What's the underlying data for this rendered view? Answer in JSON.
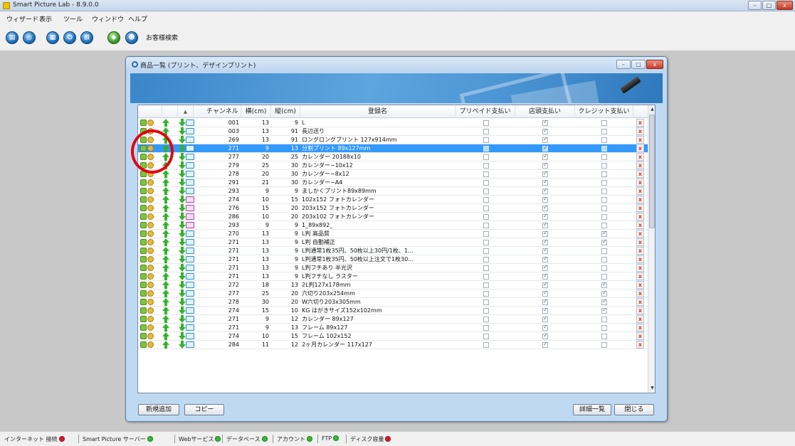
{
  "app": {
    "title": "Smart Picture Lab - 8.9.0.0"
  },
  "window_controls": {
    "minimize": "–",
    "maximize": "□",
    "close": "x"
  },
  "menu": [
    "ウィザード",
    "表示",
    "ツール",
    "ウィンドウ",
    "ヘルプ"
  ],
  "toolbar": {
    "icons": [
      "print-icon",
      "globe-icon",
      "calendar-icon",
      "power-icon",
      "network-icon",
      "photos-icon",
      "customer-icon"
    ],
    "customer_search_label": "お客様検索"
  },
  "dialog": {
    "title": "商品一覧 (プリント、デザインプリント)",
    "columns": {
      "sort_indicator": "▲",
      "channel": "チャンネル",
      "width": "横(cm)",
      "height": "縦(cm)",
      "name": "登録名",
      "prepaid": "プリペイド支払い",
      "store": "店頭支払い",
      "credit": "クレジット支払い"
    },
    "rows": [
      {
        "channel": "001",
        "w": "13",
        "h": "9",
        "name": "L",
        "prepaid": false,
        "store": true,
        "credit": false,
        "icon": "doc"
      },
      {
        "channel": "003",
        "w": "13",
        "h": "91",
        "name": "長辺送り",
        "prepaid": false,
        "store": true,
        "credit": false,
        "icon": "doc"
      },
      {
        "channel": "269",
        "w": "13",
        "h": "91",
        "name": "ロングロングプリント 127x914mm",
        "prepaid": false,
        "store": true,
        "credit": false,
        "icon": "doc"
      },
      {
        "channel": "271",
        "w": "9",
        "h": "13",
        "name": "分割プリント 89x127mm",
        "prepaid": false,
        "store": true,
        "credit": false,
        "icon": "doc",
        "selected": true
      },
      {
        "channel": "277",
        "w": "20",
        "h": "25",
        "name": "カレンダー 20188x10",
        "prepaid": false,
        "store": true,
        "credit": false,
        "icon": "doc"
      },
      {
        "channel": "279",
        "w": "25",
        "h": "30",
        "name": "カレンダー−10x12",
        "prepaid": false,
        "store": true,
        "credit": false,
        "icon": "doc"
      },
      {
        "channel": "278",
        "w": "20",
        "h": "30",
        "name": "カレンダー−8x12",
        "prepaid": false,
        "store": true,
        "credit": false,
        "icon": "doc"
      },
      {
        "channel": "291",
        "w": "21",
        "h": "30",
        "name": "カレンダー−A4",
        "prepaid": false,
        "store": true,
        "credit": false,
        "icon": "doc"
      },
      {
        "channel": "293",
        "w": "9",
        "h": "9",
        "name": "ましかくプリント89x89mm",
        "prepaid": false,
        "store": true,
        "credit": false,
        "icon": "doc"
      },
      {
        "channel": "274",
        "w": "10",
        "h": "15",
        "name": "102x152 フォトカレンダー",
        "prepaid": false,
        "store": true,
        "credit": false,
        "icon": "cal"
      },
      {
        "channel": "276",
        "w": "15",
        "h": "20",
        "name": "203x152 フォトカレンダー",
        "prepaid": false,
        "store": true,
        "credit": false,
        "icon": "cal"
      },
      {
        "channel": "286",
        "w": "10",
        "h": "20",
        "name": "203x102 フォトカレンダー",
        "prepaid": false,
        "store": true,
        "credit": false,
        "icon": "cal"
      },
      {
        "channel": "293",
        "w": "9",
        "h": "9",
        "name": "1_89x892_",
        "prepaid": false,
        "store": true,
        "credit": false,
        "icon": "cal"
      },
      {
        "channel": "270",
        "w": "13",
        "h": "9",
        "name": "L判 高品質",
        "prepaid": false,
        "store": true,
        "credit": true,
        "icon": "doc"
      },
      {
        "channel": "271",
        "w": "13",
        "h": "9",
        "name": "L判 自動補正",
        "prepaid": false,
        "store": true,
        "credit": true,
        "icon": "doc"
      },
      {
        "channel": "271",
        "w": "13",
        "h": "9",
        "name": "L判通常1枚35円、50枚以上30円/1枚、1...",
        "prepaid": false,
        "store": true,
        "credit": false,
        "icon": "doc"
      },
      {
        "channel": "271",
        "w": "13",
        "h": "9",
        "name": "L判通常1枚35円、50枚以上注文で1枚30...",
        "prepaid": false,
        "store": true,
        "credit": false,
        "icon": "doc"
      },
      {
        "channel": "271",
        "w": "13",
        "h": "9",
        "name": "L判フチあり 半光沢",
        "prepaid": false,
        "store": true,
        "credit": false,
        "icon": "doc"
      },
      {
        "channel": "271",
        "w": "13",
        "h": "9",
        "name": "L判フチなし ラスター",
        "prepaid": false,
        "store": true,
        "credit": false,
        "icon": "doc"
      },
      {
        "channel": "272",
        "w": "18",
        "h": "13",
        "name": "2L判127x178mm",
        "prepaid": false,
        "store": true,
        "credit": true,
        "icon": "doc"
      },
      {
        "channel": "277",
        "w": "25",
        "h": "20",
        "name": "六切り203x254mm",
        "prepaid": false,
        "store": true,
        "credit": true,
        "icon": "doc"
      },
      {
        "channel": "278",
        "w": "30",
        "h": "20",
        "name": "W六切り203x305mm",
        "prepaid": false,
        "store": true,
        "credit": true,
        "icon": "doc"
      },
      {
        "channel": "274",
        "w": "15",
        "h": "10",
        "name": "KG はがきサイズ152x102mm",
        "prepaid": false,
        "store": true,
        "credit": true,
        "icon": "doc"
      },
      {
        "channel": "271",
        "w": "9",
        "h": "12",
        "name": "カレンダー 89x127",
        "prepaid": false,
        "store": true,
        "credit": false,
        "icon": "doc"
      },
      {
        "channel": "271",
        "w": "9",
        "h": "13",
        "name": "フレーム 89x127",
        "prepaid": false,
        "store": true,
        "credit": false,
        "icon": "doc"
      },
      {
        "channel": "274",
        "w": "10",
        "h": "15",
        "name": "フレーム 102x152",
        "prepaid": false,
        "store": true,
        "credit": false,
        "icon": "doc"
      },
      {
        "channel": "284",
        "w": "11",
        "h": "12",
        "name": "2ヶ月カレンダー 117x127",
        "prepaid": false,
        "store": true,
        "credit": false,
        "icon": "doc"
      }
    ],
    "delete_glyph": "x",
    "buttons": {
      "add": "新規追加",
      "copy": "コピー",
      "detail": "詳細一覧",
      "close": "閉じる"
    }
  },
  "status": [
    {
      "label": "インターネット 接続",
      "color": "#e0162b"
    },
    {
      "label": "Smart Picture サーバー",
      "color": "#2fbf2f"
    },
    {
      "label": "Webサービス",
      "color": "#2fbf2f"
    },
    {
      "label": "データベース",
      "color": "#2fbf2f"
    },
    {
      "label": "アカウント",
      "color": "#2fbf2f"
    },
    {
      "label": "FTP",
      "color": "#2fbf2f"
    },
    {
      "label": "ディスク容量",
      "color": "#e0162b"
    }
  ],
  "annotation": {
    "color": "#e3000f"
  }
}
